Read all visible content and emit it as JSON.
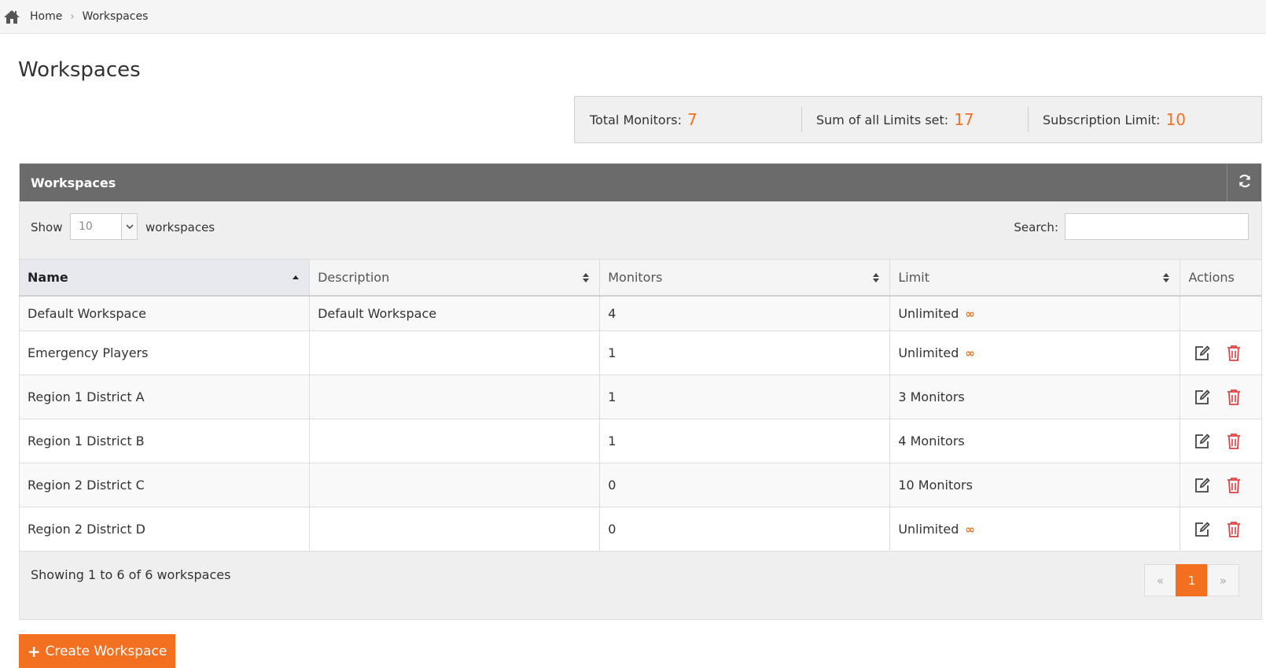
{
  "breadcrumb": {
    "home": "Home",
    "current": "Workspaces"
  },
  "page": {
    "title": "Workspaces"
  },
  "stats": {
    "total_label": "Total Monitors:",
    "total_value": "7",
    "sum_label": "Sum of all Limits set:",
    "sum_value": "17",
    "sub_label": "Subscription Limit:",
    "sub_value": "10"
  },
  "panel": {
    "title": "Workspaces",
    "show_label": "Show",
    "page_length": "10",
    "entries_label": "workspaces",
    "search_label": "Search:",
    "search_value": ""
  },
  "table": {
    "headers": {
      "name": "Name",
      "description": "Description",
      "monitors": "Monitors",
      "limit": "Limit",
      "actions": "Actions"
    },
    "rows": [
      {
        "name": "Default Workspace",
        "description": "Default Workspace",
        "monitors": "4",
        "limit": "Unlimited",
        "unlimited_symbol": "∞"
      },
      {
        "name": "Emergency Players",
        "description": "",
        "monitors": "1",
        "limit": "Unlimited",
        "unlimited_symbol": "∞"
      },
      {
        "name": "Region 1 District A",
        "description": "",
        "monitors": "1",
        "limit": "3 Monitors"
      },
      {
        "name": "Region 1 District B",
        "description": "",
        "monitors": "1",
        "limit": "4 Monitors"
      },
      {
        "name": "Region 2 District C",
        "description": "",
        "monitors": "0",
        "limit": "10 Monitors"
      },
      {
        "name": "Region 2 District D",
        "description": "",
        "monitors": "0",
        "limit": "Unlimited",
        "unlimited_symbol": "∞"
      }
    ]
  },
  "footer": {
    "info": "Showing 1 to 6 of 6 workspaces",
    "pager_prev": "«",
    "pager_current": "1",
    "pager_next": "»"
  },
  "create_button": {
    "plus": "+",
    "label": "Create Workspace"
  },
  "colors": {
    "accent": "#f37021",
    "header_bg": "#6b6b6b",
    "delete_red": "#e04040"
  },
  "icons": {
    "home": "home-icon",
    "refresh": "refresh-icon",
    "sort_asc": "sort-asc-icon",
    "sort_both": "sort-icon",
    "edit": "edit-icon",
    "delete": "trash-icon",
    "dropdown": "chevron-down-icon"
  }
}
